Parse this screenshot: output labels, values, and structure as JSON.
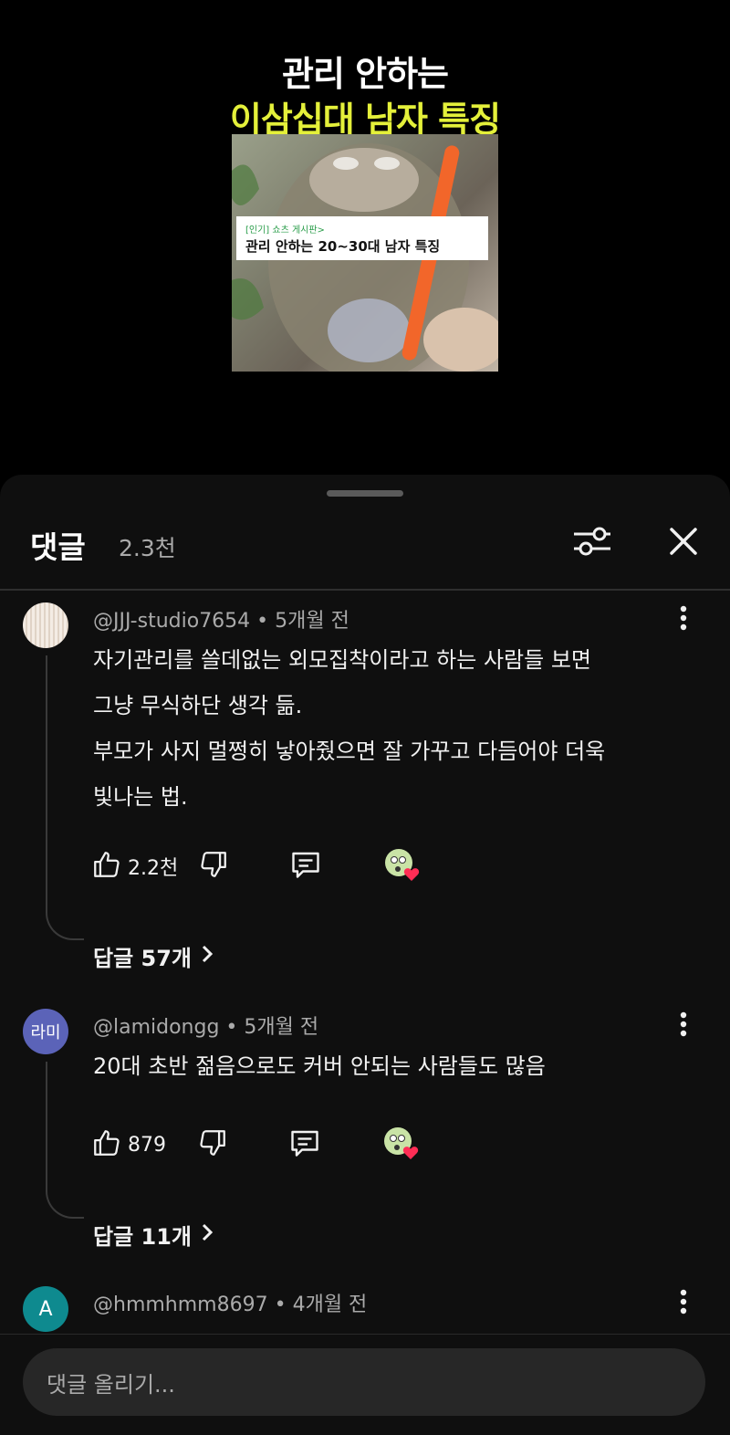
{
  "video": {
    "title_line1": "관리 안하는",
    "title_line2": "이삼십대 남자 특징",
    "card_tag": "[인기] 쇼츠 게시판>",
    "card_text": "관리 안하는 20~30대 남자 특징"
  },
  "panel": {
    "title": "댓글",
    "count": "2.3천"
  },
  "comments": [
    {
      "author": "@JJJ-studio7654",
      "time": "5개월 전",
      "lines": [
        "자기관리를 쓸데없는 외모집착이라고 하는 사람들 보면",
        "그냥 무식하단 생각 듦.",
        "부모가 사지 멀쩡히 낳아줬으면 잘 가꾸고 다듬어야 더욱",
        "빛나는 법."
      ],
      "likes": "2.2천",
      "replies": "답글 57개",
      "avatar_text": ""
    },
    {
      "author": "@lamidongg",
      "time": "5개월 전",
      "lines": [
        "20대 초반 젊음으로도 커버 안되는 사람들도 많음"
      ],
      "likes": "879",
      "replies": "답글 11개",
      "avatar_text": "라미"
    },
    {
      "author": "@hmmhmm8697",
      "time": "4개월 전",
      "lines": [],
      "likes": "",
      "replies": "",
      "avatar_text": "A"
    }
  ],
  "composer": {
    "placeholder": "댓글 올리기..."
  },
  "colors": {
    "accent_yellow": "#e4f03a",
    "avatar_lami": "#5b63b8",
    "avatar_a": "#0e8a8f",
    "heart": "#ff2d55"
  }
}
